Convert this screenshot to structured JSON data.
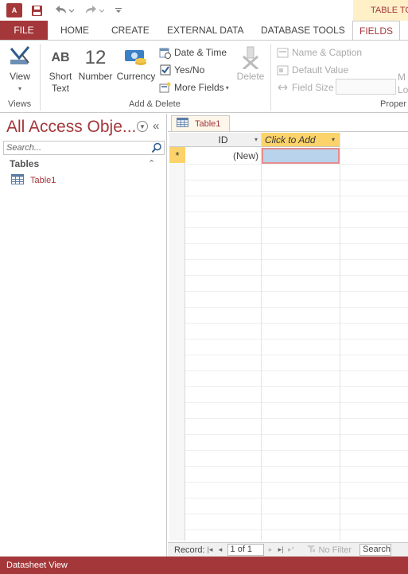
{
  "quick_access": {
    "app_icon_label": "A"
  },
  "context_tab": {
    "label": "TABLE TO"
  },
  "tabs": {
    "file": "FILE",
    "home": "HOME",
    "create": "CREATE",
    "external": "EXTERNAL DATA",
    "dbtools": "DATABASE TOOLS",
    "fields": "FIELDS"
  },
  "ribbon": {
    "view": "View",
    "short_text_icon": "AB",
    "short_text_1": "Short",
    "short_text_2": "Text",
    "number_icon": "12",
    "number": "Number",
    "currency": "Currency",
    "date_time": "Date & Time",
    "yes_no": "Yes/No",
    "more_fields": "More Fields",
    "delete": "Delete",
    "name_caption": "Name & Caption",
    "default_value": "Default Value",
    "field_size": "Field Size",
    "ml_1": "M",
    "ml_2": "Lo",
    "groups": {
      "views": "Views",
      "add_delete": "Add & Delete",
      "properties": "Proper"
    }
  },
  "nav_pane": {
    "title": "All Access Obje...",
    "search_placeholder": "Search...",
    "group": "Tables",
    "items": [
      {
        "label": "Table1"
      }
    ]
  },
  "document": {
    "tab": "Table1",
    "columns": {
      "id": "ID",
      "click_to_add": "Click to Add"
    },
    "new_row": {
      "marker": "*",
      "id": "(New)"
    }
  },
  "record_nav": {
    "label": "Record:",
    "position": "1 of 1",
    "no_filter": "No Filter",
    "search": "Search"
  },
  "status_bar": {
    "text": "Datasheet View"
  },
  "colors": {
    "accent": "#a4373a",
    "context_bg": "#fff0c8",
    "header_highlight": "#fbd36a"
  }
}
